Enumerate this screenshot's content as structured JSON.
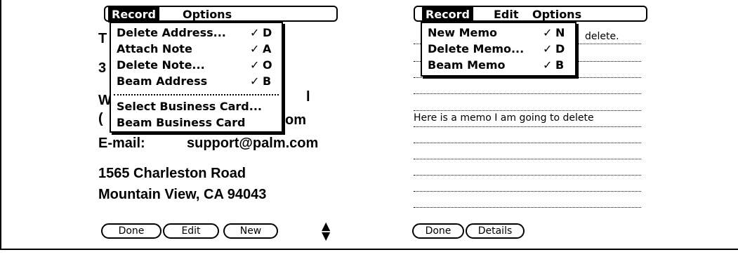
{
  "left": {
    "menus": [
      "Record",
      "Options"
    ],
    "selected_menu": "Record",
    "record_menu": [
      {
        "label": "Delete Address...",
        "shortcut": "D"
      },
      {
        "label": "Attach Note",
        "shortcut": "A"
      },
      {
        "label": "Delete Note...",
        "shortcut": "O"
      },
      {
        "label": "Beam Address",
        "shortcut": "B"
      },
      {
        "label": "Select Business Card...",
        "shortcut": ""
      },
      {
        "label": "Beam Business Card",
        "shortcut": ""
      }
    ],
    "card_fragments": [
      "T",
      "3",
      "W",
      "(",
      "l",
      "om"
    ],
    "email_label": "E-mail:",
    "email_value": "support@palm.com",
    "address_line1": "1565 Charleston Road",
    "address_line2": "Mountain View, CA  94043",
    "buttons": [
      "Done",
      "Edit",
      "New"
    ]
  },
  "right": {
    "menus": [
      "Record",
      "Edit",
      "Options"
    ],
    "selected_menu": "Record",
    "record_menu": [
      {
        "label": "New Memo",
        "shortcut": "N"
      },
      {
        "label": "Delete Memo...",
        "shortcut": "D"
      },
      {
        "label": "Beam Memo",
        "shortcut": "B"
      }
    ],
    "memo_fragment": "delete.",
    "memo_line": "Here is a memo I am going to delete",
    "buttons": [
      "Done",
      "Details"
    ]
  },
  "glyphs": {
    "shortcut_stroke": "✓",
    "scroll_up": "▲",
    "scroll_down": "▼"
  }
}
